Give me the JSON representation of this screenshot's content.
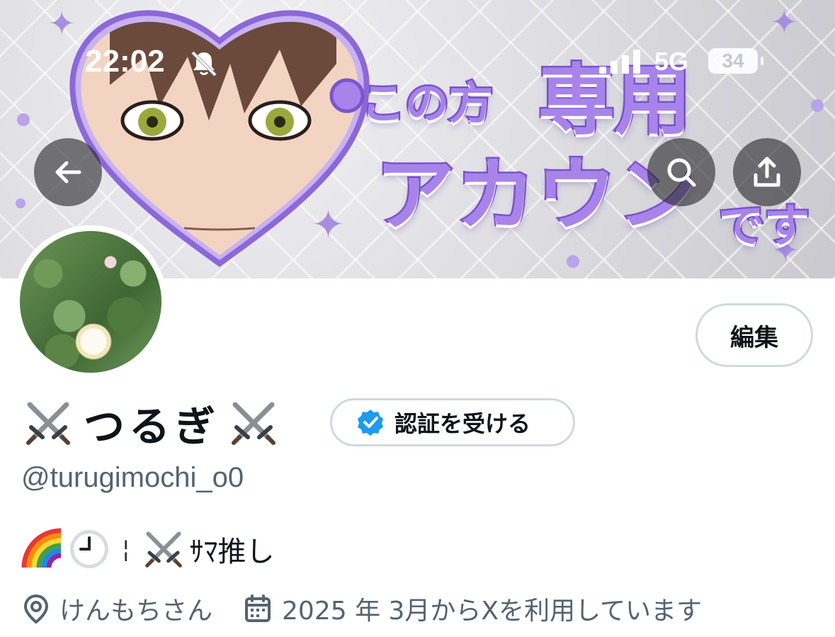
{
  "status_bar": {
    "time": "22:02",
    "network": "5G",
    "battery": "34",
    "icons": [
      "bell-muted-icon",
      "cellular-signal-icon",
      "battery-icon"
    ]
  },
  "banner": {
    "text_line1a": "この方",
    "text_line1b": "専用",
    "text_line2a": "アカウン",
    "text_line2b": "です",
    "accent_color": "#a884ea"
  },
  "header_actions": {
    "back_icon": "arrow-left-icon",
    "search_icon": "search-icon",
    "share_icon": "share-icon"
  },
  "profile": {
    "edit_label": "編集",
    "display_name": "つるぎ",
    "name_emoji": "crossed-swords-icon",
    "verify_label": "認証を受ける",
    "handle": "@turugimochi_o0",
    "bio_text": "ｻﾏ推し",
    "bio_separator": "¦",
    "location": "けんもちさん",
    "joined": "2025 年 3月からXを利用しています"
  },
  "colors": {
    "text_primary": "#0f1419",
    "text_secondary": "#536471",
    "border": "#cfd9de",
    "verified_blue": "#1d9bf0"
  }
}
